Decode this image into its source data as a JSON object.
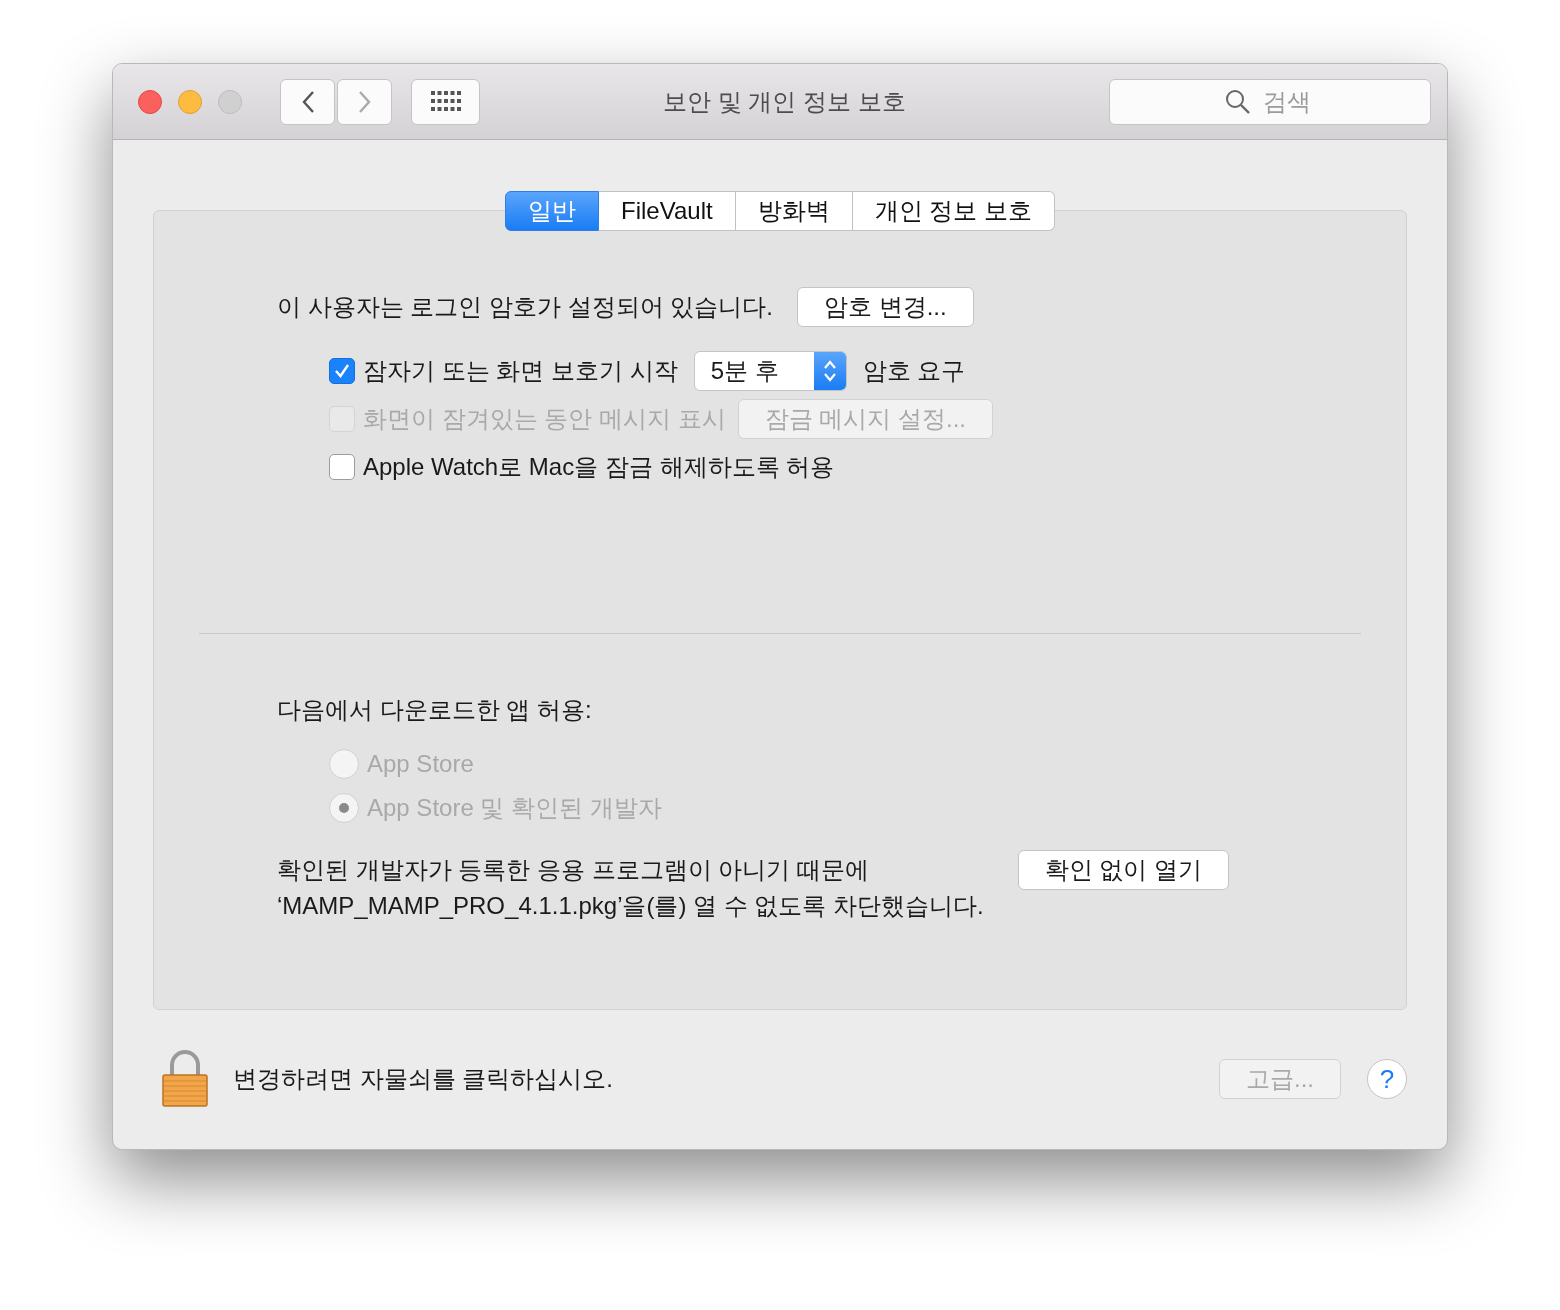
{
  "window": {
    "title": "보안 및 개인 정보 보호"
  },
  "search": {
    "placeholder": "검색"
  },
  "tabs": [
    {
      "label": "일반",
      "selected": true
    },
    {
      "label": "FileVault",
      "selected": false
    },
    {
      "label": "방화벽",
      "selected": false
    },
    {
      "label": "개인 정보 보호",
      "selected": false
    }
  ],
  "general": {
    "password_text": "이 사용자는 로그인 암호가 설정되어 있습니다.",
    "change_password_button": "암호 변경...",
    "options": [
      {
        "kind": "select",
        "label": "잠자기 또는 화면 보호기 시작",
        "checked": true,
        "disabled": false,
        "select_value": "5분 후",
        "suffix": "암호 요구"
      },
      {
        "kind": "button",
        "label": "화면이 잠겨있는 동안 메시지 표시",
        "checked": false,
        "disabled": true,
        "button": "잠금 메시지 설정..."
      },
      {
        "kind": "plain",
        "label": "Apple Watch로 Mac을 잠금 해제하도록 허용",
        "checked": false,
        "disabled": false
      }
    ]
  },
  "downloads": {
    "heading": "다음에서 다운로드한 앱 허용:",
    "options": [
      {
        "label": "App Store",
        "selected": false,
        "disabled": true
      },
      {
        "label": "App Store 및 확인된 개발자",
        "selected": true,
        "disabled": true
      }
    ],
    "blocked_message": "확인된 개발자가 등록한 응용 프로그램이 아니기 때문에\n‘MAMP_MAMP_PRO_4.1.1.pkg’을(를) 열 수 없도록 차단했습니다.",
    "open_anyway_button": "확인 없이 열기"
  },
  "footer": {
    "lock_text": "변경하려면 자물쇠를 클릭하십시오.",
    "advanced_button": {
      "label": "고급...",
      "disabled": true
    },
    "help_button": "?"
  }
}
